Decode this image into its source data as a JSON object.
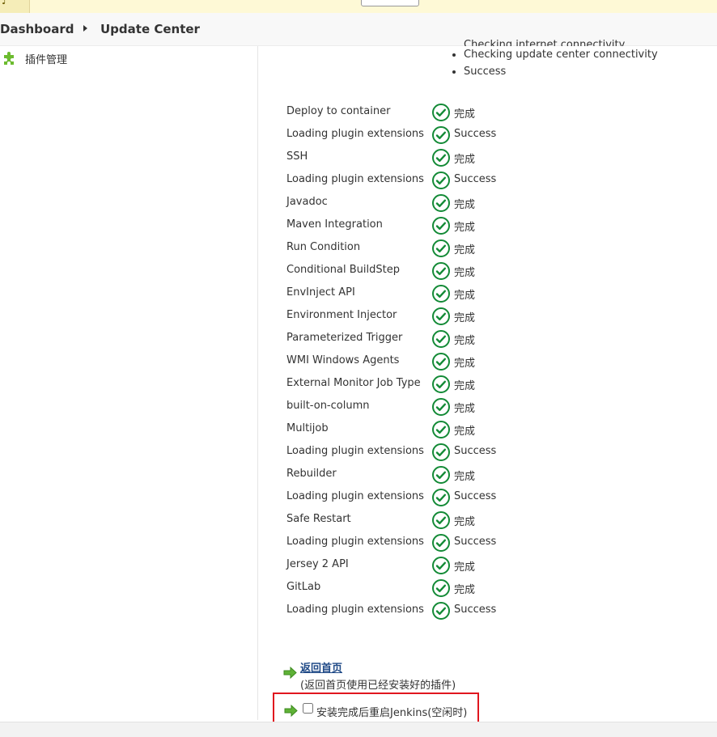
{
  "breadcrumb": {
    "items": [
      {
        "label": "Dashboard"
      },
      {
        "label": "Update Center"
      }
    ]
  },
  "sidebar": {
    "items": [
      {
        "label": "插件管理",
        "icon": "puzzle-piece-icon",
        "color": "#6cbb2f"
      }
    ]
  },
  "checks": {
    "items": [
      "Checking internet connectivity",
      "Checking update center connectivity",
      "Success"
    ]
  },
  "status_rows": [
    {
      "name": "Deploy to container",
      "status": "完成"
    },
    {
      "name": "Loading plugin extensions",
      "status": "Success"
    },
    {
      "name": "SSH",
      "status": "完成"
    },
    {
      "name": "Loading plugin extensions",
      "status": "Success"
    },
    {
      "name": "Javadoc",
      "status": "完成"
    },
    {
      "name": "Maven Integration",
      "status": "完成"
    },
    {
      "name": "Run Condition",
      "status": "完成"
    },
    {
      "name": "Conditional BuildStep",
      "status": "完成"
    },
    {
      "name": "EnvInject API",
      "status": "完成"
    },
    {
      "name": "Environment Injector",
      "status": "完成"
    },
    {
      "name": "Parameterized Trigger",
      "status": "完成"
    },
    {
      "name": "WMI Windows Agents",
      "status": "完成"
    },
    {
      "name": "External Monitor Job Type",
      "status": "完成"
    },
    {
      "name": "built-on-column",
      "status": "完成"
    },
    {
      "name": "Multijob",
      "status": "完成"
    },
    {
      "name": "Loading plugin extensions",
      "status": "Success"
    },
    {
      "name": "Rebuilder",
      "status": "完成"
    },
    {
      "name": "Loading plugin extensions",
      "status": "Success"
    },
    {
      "name": "Safe Restart",
      "status": "完成"
    },
    {
      "name": "Loading plugin extensions",
      "status": "Success"
    },
    {
      "name": "Jersey 2 API",
      "status": "完成"
    },
    {
      "name": "GitLab",
      "status": "完成"
    },
    {
      "name": "Loading plugin extensions",
      "status": "Success"
    }
  ],
  "status_icon": "check-circle-icon",
  "colors": {
    "success": "#138a36",
    "link": "#204a87",
    "arrow": "#5fb236",
    "highlight_border": "#e0161e"
  },
  "footer_actions": {
    "home_link": "返回首页",
    "home_hint": "(返回首页使用已经安装好的插件)",
    "restart_label": "安装完成后重启Jenkins(空闲时)",
    "restart_checked": false
  }
}
